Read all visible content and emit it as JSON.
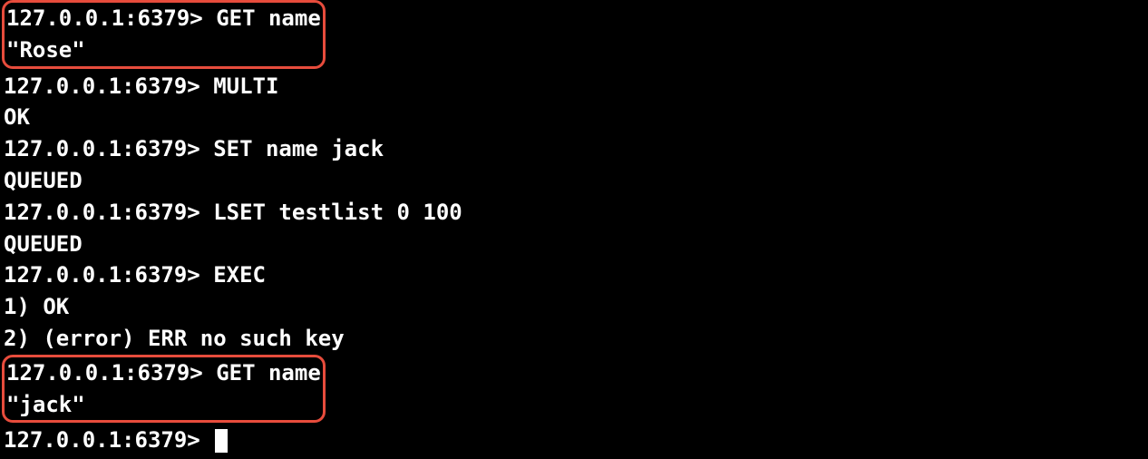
{
  "terminal": {
    "prompt": "127.0.0.1:6379>",
    "lines": {
      "l1_cmd": "127.0.0.1:6379> GET name",
      "l1_out": "\"Rose\"",
      "l2_cmd": "127.0.0.1:6379> MULTI",
      "l2_out": "OK",
      "l3_cmd": "127.0.0.1:6379> SET name jack",
      "l3_out": "QUEUED",
      "l4_cmd": "127.0.0.1:6379> LSET testlist 0 100",
      "l4_out": "QUEUED",
      "l5_cmd": "127.0.0.1:6379> EXEC",
      "l5_out1": "1) OK",
      "l5_out2": "2) (error) ERR no such key",
      "l6_cmd": "127.0.0.1:6379> GET name",
      "l6_out": "\"jack\"",
      "l7_cmd": "127.0.0.1:6379> "
    }
  }
}
